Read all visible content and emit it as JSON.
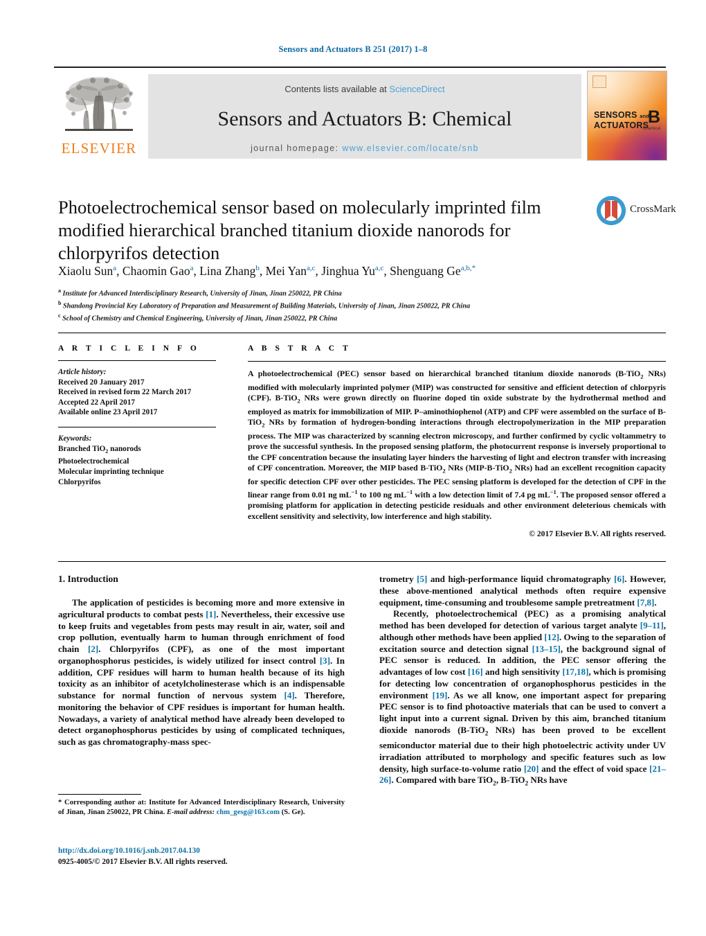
{
  "running_head": "Sensors and Actuators B 251 (2017) 1–8",
  "masthead": {
    "contents_prefix": "Contents lists available at ",
    "sciencedirect": "ScienceDirect",
    "journal_title": "Sensors and Actuators B: Chemical",
    "homepage_prefix": "journal homepage: ",
    "homepage_url": "www.elsevier.com/locate/snb",
    "publisher": "ELSEVIER",
    "cover": {
      "sensors": "SENSORS",
      "and": "and",
      "actuators": "ACTUATORS",
      "letter": "B",
      "sub": "Chemical"
    },
    "link_color": "#4ba3d3",
    "band_color": "#e3e3e3"
  },
  "article": {
    "title": "Photoelectrochemical sensor based on molecularly imprinted film modified hierarchical branched titanium dioxide nanorods for chlorpyrifos detection",
    "crossmark_label": "CrossMark",
    "authors_html": "Xiaolu Sun<sup>a</sup>, Chaomin Gao<sup>a</sup>, Lina Zhang<sup>b</sup>, Mei Yan<sup>a,c</sup>, Jinghua Yu<sup>a,c</sup>, Shenguang Ge<sup>a,b,*</sup>",
    "affiliations": [
      {
        "marker": "a",
        "text": "Institute for Advanced Interdisciplinary Research, University of Jinan, Jinan 250022, PR China"
      },
      {
        "marker": "b",
        "text": "Shandong Provincial Key Laboratory of Preparation and Measurement of Building Materials, University of Jinan, Jinan 250022, PR China"
      },
      {
        "marker": "c",
        "text": "School of Chemistry and Chemical Engineering, University of Jinan, Jinan 250022, PR China"
      }
    ]
  },
  "article_info": {
    "heading": "A R T I C L E    I N F O",
    "history_label": "Article history:",
    "history": [
      "Received 20 January 2017",
      "Received in revised form 22 March 2017",
      "Accepted 22 April 2017",
      "Available online 23 April 2017"
    ],
    "keywords_label": "Keywords:",
    "keywords_html": [
      "Branched TiO<sub>2</sub> nanorods",
      "Photoelectrochemical",
      "Molecular imprinting technique",
      "Chlorpyrifos"
    ]
  },
  "abstract": {
    "heading": "A B S T R A C T",
    "text_html": "A photoelectrochemical (PEC) sensor based on hierarchical branched titanium dioxide nanorods (B-TiO<sub>2</sub> NRs) modified with molecularly imprinted polymer (MIP) was constructed for sensitive and efficient detection of chlorpyris (CPF). B-TiO<sub>2</sub> NRs were grown directly on fluorine doped tin oxide substrate by the hydrothermal method and employed as matrix for immobilization of MIP. P–aminothiophenol (ATP) and CPF were assembled on the surface of B-TiO<sub>2</sub> NRs by formation of hydrogen-bonding interactions through electropolymerization in the MIP preparation process. The MIP was characterized by scanning electron microscopy, and further confirmed by cyclic voltammetry to prove the successful synthesis. In the proposed sensing platform, the photocurrent response is inversely proportional to the CPF concentration because the insulating layer hinders the harvesting of light and electron transfer with increasing of CPF concentration. Moreover, the MIP based B-TiO<sub>2</sub> NRs (MIP-B-TiO<sub>2</sub> NRs) had an excellent recognition capacity for specific detection CPF over other pesticides. The PEC sensing platform is developed for the detection of CPF in the linear range from 0.01 ng mL<sup class=\"num\">−1</sup> to 100 ng mL<sup class=\"num\">−1</sup> with a low detection limit of 7.4 pg mL<sup class=\"num\">−1</sup>. The proposed sensor offered a promising platform for application in detecting pesticide residuals and other environment deleterious chemicals with excellent sensitivity and selectivity, low interference and high stability.",
    "copyright": "© 2017 Elsevier B.V. All rights reserved."
  },
  "body": {
    "section_number_title": "1.  Introduction",
    "left_column_html": "<p class=\"ind\">The application of pesticides is becoming more and more extensive in agricultural products to combat pests <span class=\"ref\">[1]</span>. Nevertheless, their excessive use to keep fruits and vegetables from pests may result in air, water, soil and crop pollution, eventually harm to human through enrichment of food chain <span class=\"ref\">[2]</span>. Chlorpyrifos (CPF), as one of the most important organophosphorus pesticides, is widely utilized for insect control <span class=\"ref\">[3]</span>. In addition, CPF residues will harm to human health because of its high toxicity as an inhibitor of acetylcholinesterase which is an indispensable substance for normal function of nervous system <span class=\"ref\">[4]</span>. Therefore, monitoring the behavior of CPF residues is important for human health. Nowadays, a variety of analytical method have already been developed to detect organophosphorus pesticides by using of complicated techniques, such as gas chromatography-mass spec-</p>",
    "right_column_html": "<p>trometry <span class=\"ref\">[5]</span> and high-performance liquid chromatography <span class=\"ref\">[6]</span>. However, these above-mentioned analytical methods often require expensive equipment, time-consuming and troublesome sample pretreatment <span class=\"ref\">[7,8]</span>.</p><p class=\"ind\">Recently, photoelectrochemical (PEC) as a promising analytical method has been developed for detection of various target analyte <span class=\"ref\">[9–11]</span>, although other methods have been applied <span class=\"ref\">[12]</span>. Owing to the separation of excitation source and detection signal <span class=\"ref\">[13–15]</span>, the background signal of PEC sensor is reduced. In addition, the PEC sensor offering the advantages of low cost <span class=\"ref\">[16]</span> and high sensitivity <span class=\"ref\">[17,18]</span>, which is promising for detecting low concentration of organophosphorus pesticides in the environment <span class=\"ref\">[19]</span>. As we all know, one important aspect for preparing PEC sensor is to find photoactive materials that can be used to convert a light input into a current signal. Driven by this aim, branched titanium dioxide nanorods (B-TiO<sub>2</sub> NRs) has been proved to be excellent semiconductor material due to their high photoelectric activity under UV irradiation attributed to morphology and specific features such as low density, high surface-to-volume ratio <span class=\"ref\">[20]</span> and the effect of void space <span class=\"ref\">[21–26]</span>. Compared with bare TiO<sub>2</sub>, B-TiO<sub>2</sub> NRs have</p>"
  },
  "footer": {
    "corresponding_html": "<span class=\"fn-ind\">* Corresponding author at: Institute for Advanced Interdisciplinary Research, University of Jinan, Jinan 250022, PR China.</span>",
    "email_label": "E-mail address:",
    "email": "chm_gesg@163.com",
    "email_suffix": "(S. Ge).",
    "doi": "http://dx.doi.org/10.1016/j.snb.2017.04.130",
    "issn_line": "0925-4005/© 2017 Elsevier B.V. All rights reserved.",
    "link_color": "#0b72a8"
  }
}
